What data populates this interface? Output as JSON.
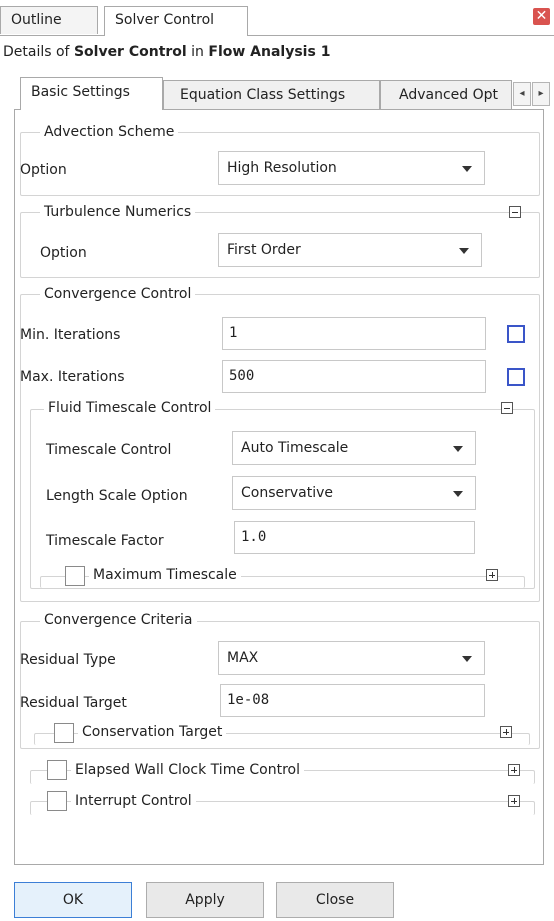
{
  "top_tabs": [
    "Outline",
    "Solver Control"
  ],
  "details": {
    "prefix": "Details of ",
    "object": "Solver Control",
    "middle": " in ",
    "analysis": "Flow Analysis 1"
  },
  "inner_tabs": [
    "Basic Settings",
    "Equation Class Settings",
    "Advanced Opt"
  ],
  "advection": {
    "title": "Advection Scheme",
    "option_label": "Option",
    "option_value": "High Resolution"
  },
  "turbulence": {
    "title": "Turbulence Numerics",
    "option_label": "Option",
    "option_value": "First Order"
  },
  "convergence": {
    "title": "Convergence Control",
    "min_label": "Min. Iterations",
    "min_value": "1",
    "max_label": "Max. Iterations",
    "max_value": "500",
    "fluid": {
      "title": "Fluid Timescale Control",
      "tc_label": "Timescale Control",
      "tc_value": "Auto Timescale",
      "ls_label": "Length Scale Option",
      "ls_value": "Conservative",
      "tf_label": "Timescale Factor",
      "tf_value": "1.0",
      "max_ts_label": "Maximum Timescale"
    }
  },
  "criteria": {
    "title": "Convergence Criteria",
    "rt_label": "Residual Type",
    "rt_value": "MAX",
    "target_label": "Residual Target",
    "target_value": "1e-08",
    "conservation_label": "Conservation Target"
  },
  "elapsed_label": "Elapsed Wall Clock Time Control",
  "interrupt_label": "Interrupt Control",
  "buttons": {
    "ok": "OK",
    "apply": "Apply",
    "close": "Close"
  }
}
